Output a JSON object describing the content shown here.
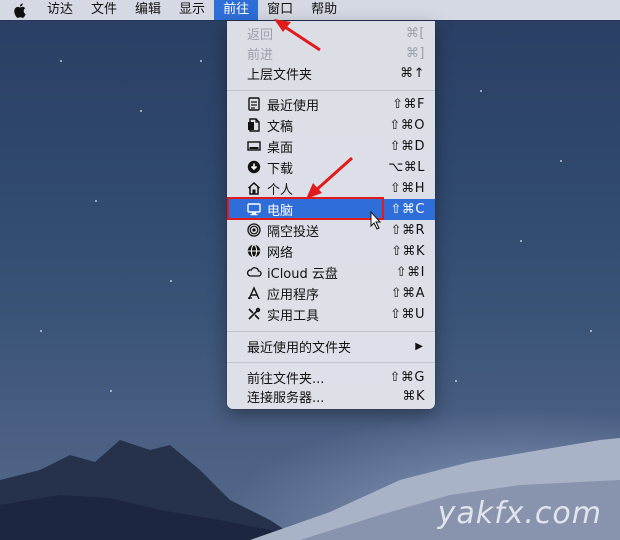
{
  "menubar": {
    "items": [
      "访达",
      "文件",
      "编辑",
      "显示",
      "前往",
      "窗口",
      "帮助"
    ],
    "active_index": 4
  },
  "go_menu": {
    "back": {
      "label": "返回",
      "shortcut": "⌘["
    },
    "forward": {
      "label": "前进",
      "shortcut": "⌘]"
    },
    "enclosing": {
      "label": "上层文件夹",
      "shortcut": "⌘↑"
    },
    "items": [
      {
        "label": "最近使用",
        "shortcut": "⇧⌘F",
        "icon": "recents-icon"
      },
      {
        "label": "文稿",
        "shortcut": "⇧⌘O",
        "icon": "documents-icon"
      },
      {
        "label": "桌面",
        "shortcut": "⇧⌘D",
        "icon": "desktop-icon"
      },
      {
        "label": "下载",
        "shortcut": "⌥⌘L",
        "icon": "downloads-icon"
      },
      {
        "label": "个人",
        "shortcut": "⇧⌘H",
        "icon": "home-icon"
      },
      {
        "label": "电脑",
        "shortcut": "⇧⌘C",
        "icon": "computer-icon"
      },
      {
        "label": "隔空投送",
        "shortcut": "⇧⌘R",
        "icon": "airdrop-icon"
      },
      {
        "label": "网络",
        "shortcut": "⇧⌘K",
        "icon": "network-icon"
      },
      {
        "label": "iCloud 云盘",
        "shortcut": "⇧⌘I",
        "icon": "icloud-icon"
      },
      {
        "label": "应用程序",
        "shortcut": "⇧⌘A",
        "icon": "applications-icon"
      },
      {
        "label": "实用工具",
        "shortcut": "⇧⌘U",
        "icon": "utilities-icon"
      }
    ],
    "recent_folders": {
      "label": "最近使用的文件夹",
      "submenu_glyph": "▶"
    },
    "go_to_folder": {
      "label": "前往文件夹...",
      "shortcut": "⇧⌘G"
    },
    "connect_server": {
      "label": "连接服务器...",
      "shortcut": "⌘K"
    }
  },
  "watermark": "yakfx.com",
  "colors": {
    "highlight": "#2f6ed8",
    "annotation": "#e11b1b"
  }
}
